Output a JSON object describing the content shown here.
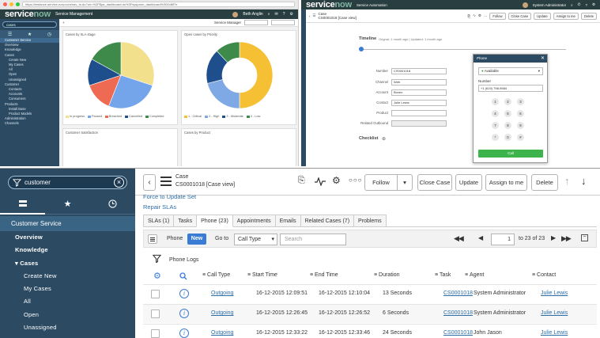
{
  "top_left": {
    "chrome_url": "https://instance.service-now.com/nav_to.do?uri=%2F$pa_dashboard.do%3Fsysparm_dashboard%3D0d8f7e",
    "brand_service": "service",
    "brand_now": "now",
    "app_name": "Service Management",
    "dashboard_label": "Service Manager",
    "user_name": "Beth Anglin",
    "filter_search": "cases",
    "nav_items": [
      "Customer Service",
      "Overview",
      "Knowledge",
      "Cases",
      "Create New",
      "My Cases",
      "All",
      "Open",
      "Unassigned",
      "Customer",
      "Contacts",
      "Accounts",
      "Consumers",
      "Products",
      "Install Base",
      "Product Models",
      "Administration",
      "Channels"
    ],
    "card1_title": "Cases by SLA stage",
    "card2_title": "Open cases by Priority",
    "card3_title": "Customer Satisfaction",
    "card4_title": "Cases by Product",
    "pie_legend": [
      "In progress",
      "Paused",
      "Breached",
      "Cancelled",
      "Completed"
    ],
    "donut_legend": [
      "1 - Critical",
      "2 - High",
      "3 - Moderate",
      "4 - Low"
    ]
  },
  "chart_data": [
    {
      "type": "pie",
      "title": "Cases by SLA stage",
      "categories": [
        "In progress",
        "Paused",
        "Breached",
        "Cancelled",
        "Completed"
      ],
      "values": [
        30,
        26,
        14,
        13,
        17
      ],
      "colors": [
        "#f3e08d",
        "#74a5ea",
        "#ef6a52",
        "#1f4e8d",
        "#3e8a4a"
      ]
    },
    {
      "type": "pie",
      "title": "Open cases by Priority",
      "categories": [
        "1 - Critical",
        "2 - High",
        "3 - Moderate",
        "4 - Low"
      ],
      "values": [
        50,
        21,
        17,
        12
      ],
      "colors": [
        "#f5c033",
        "#7fa9e5",
        "#1f4e8d",
        "#3e8a4a"
      ]
    }
  ],
  "top_right": {
    "brand_service": "service",
    "brand_now": "now",
    "app_name": "Service Automation",
    "user_name": "System Administrator",
    "case_label": "Case",
    "case_number": "CS0001018 [Case view]",
    "follow": "Follow",
    "close_case": "Close Case",
    "update": "Update",
    "assign_to_me": "Assign to me",
    "delete": "Delete",
    "timeline_title": "Timeline",
    "timeline_sub": "Orignal: 1 month ago | Updated: 1 month ago",
    "labels": [
      "Number",
      "Channel",
      "Account",
      "Contact",
      "Product",
      "Related Outbound"
    ],
    "values": [
      "CS0001018",
      "Web",
      "Boxeo",
      "Julie Lewis",
      "",
      ""
    ],
    "checklist": "Checklist",
    "phone": {
      "title": "Phone",
      "status": "Available",
      "number_label": "Number",
      "number_value": "+1 (619) 798-9584",
      "keys": [
        "1",
        "2",
        "3",
        "4",
        "5",
        "6",
        "7",
        "8",
        "9",
        "*",
        "0",
        "#"
      ],
      "call": "Call"
    }
  },
  "bottom": {
    "search": "customer",
    "nav": {
      "section": "Customer Service",
      "items": [
        "Overview",
        "Knowledge",
        "Cases",
        "Create New",
        "My Cases",
        "All",
        "Open",
        "Unassigned"
      ]
    },
    "header": {
      "case_label": "Case",
      "case_number": "CS0001018 [Case view]",
      "follow": "Follow",
      "close_case": "Close Case",
      "update": "Update",
      "assign_to_me": "Assign to me",
      "delete": "Delete"
    },
    "related_links": [
      "Force to Update Set",
      "Repair SLAs"
    ],
    "tabs": [
      "SLAs (1)",
      "Tasks",
      "Phone (23)",
      "Appointments",
      "Emails",
      "Related Cases (7)",
      "Problems"
    ],
    "list": {
      "label": "Phone",
      "new": "New",
      "goto": "Go to",
      "field": "Call Type",
      "search_placeholder": "Search",
      "page": "1",
      "page_total": "to 23 of 23",
      "filter_label": "Phone Logs",
      "columns": [
        "Call Type",
        "Start Time",
        "End Time",
        "Duration",
        "Task",
        "Agent",
        "Contact"
      ],
      "rows": [
        [
          "Outgoing",
          "16-12-2015 12:09:51",
          "16-12-2015 12:10:04",
          "13 Seconds",
          "CS0001018",
          "System Administrator",
          "Julie Lewis"
        ],
        [
          "Outgoing",
          "16-12-2015 12:26:45",
          "16-12-2015 12:26:52",
          "6 Seconds",
          "CS0001018",
          "System Administrator",
          "Julie Lewis"
        ],
        [
          "Outgoing",
          "16-12-2015 12:33:22",
          "16-12-2015 12:33:46",
          "24 Seconds",
          "CS0001018",
          "John Jason",
          "Julie Lewis"
        ]
      ]
    }
  }
}
